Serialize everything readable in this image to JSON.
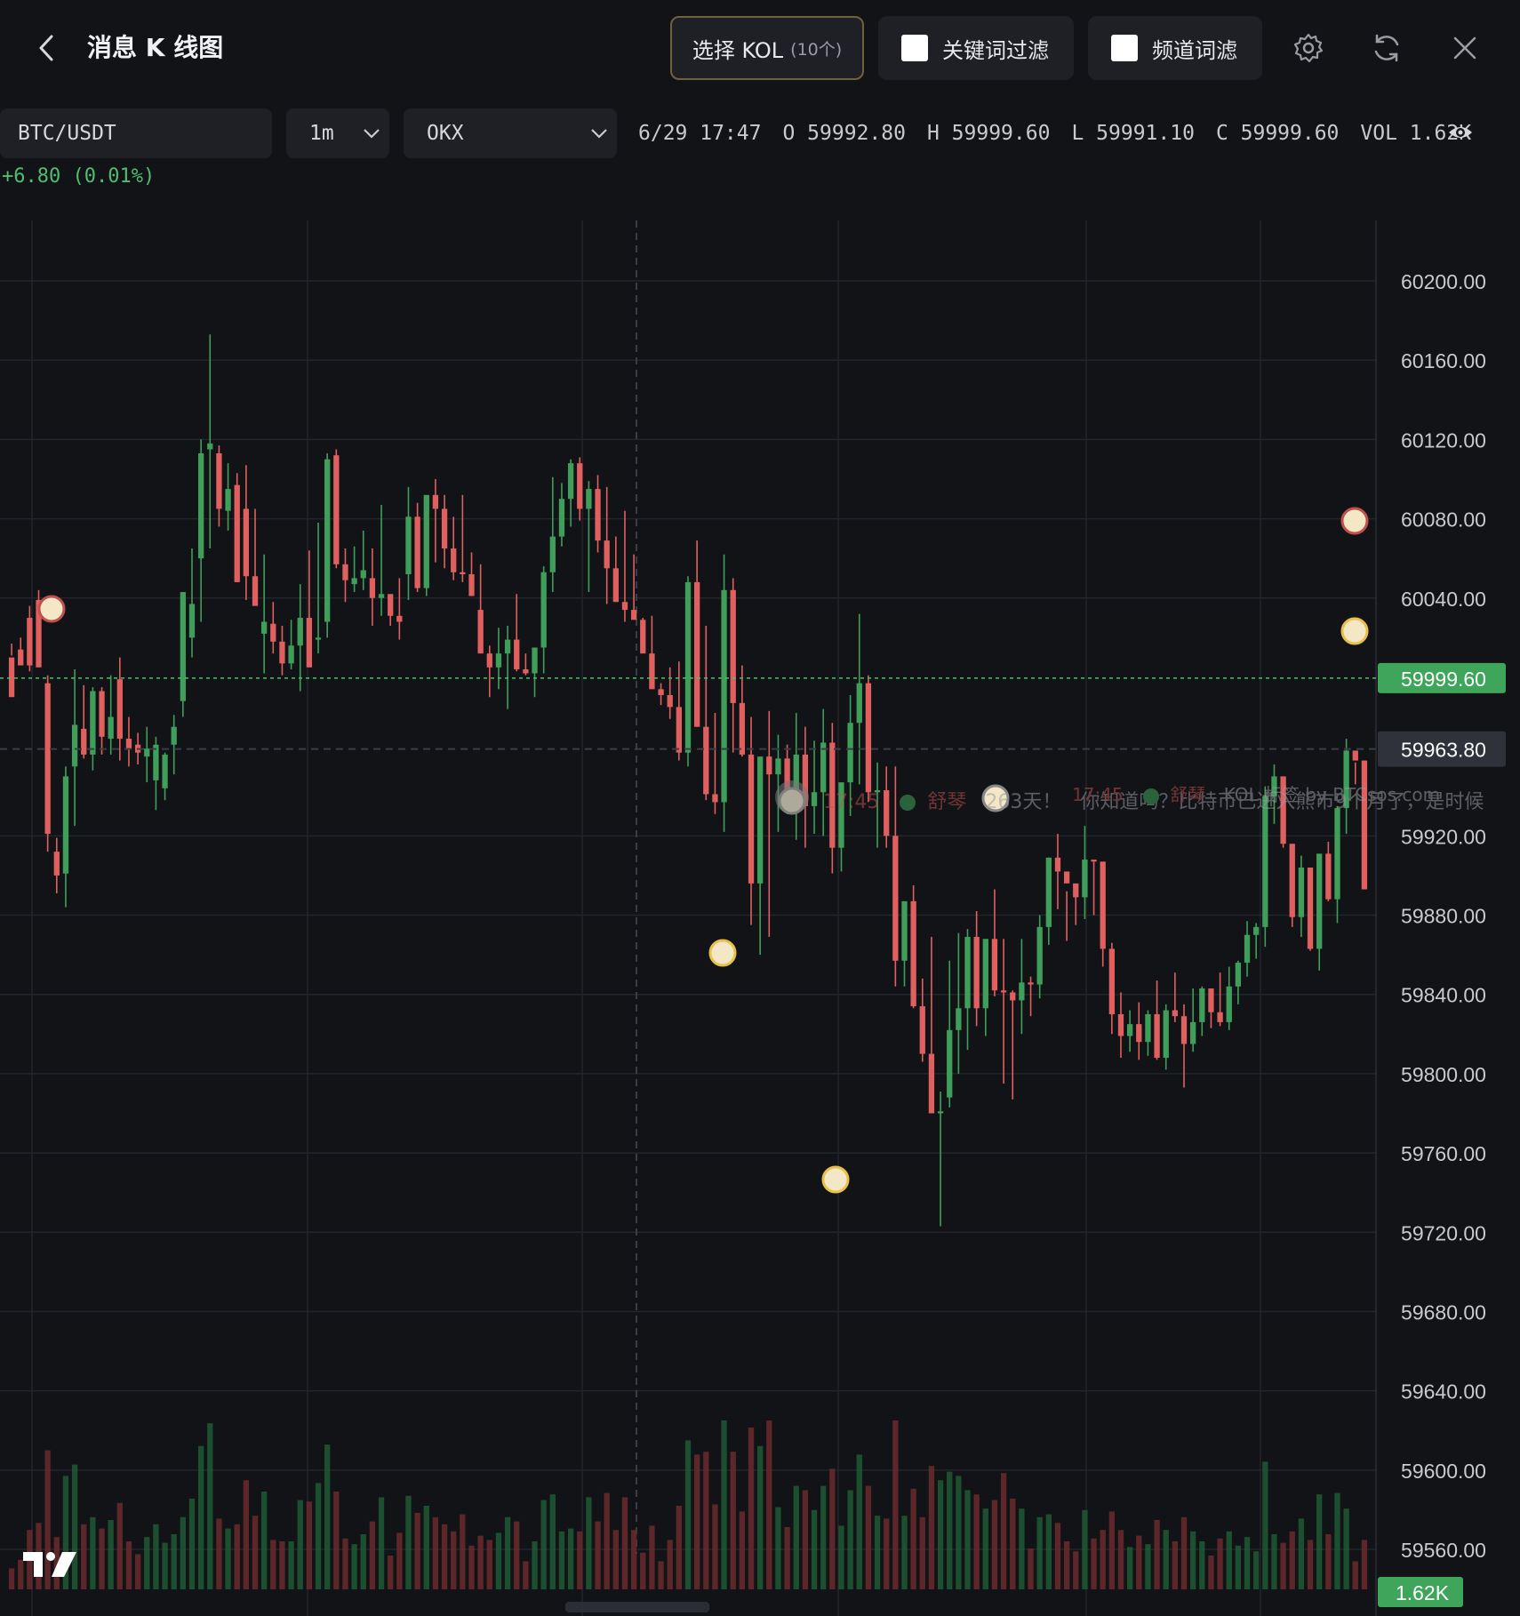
{
  "header": {
    "title": "消息 K 线图",
    "kol_button": "选择 KOL",
    "kol_count": "(10个)",
    "keyword_filter": "关键词过滤",
    "channel_filter": "频道词滤"
  },
  "toolbar": {
    "pair": "BTC/USDT",
    "interval": "1m",
    "exchange": "OKX"
  },
  "ohlc": {
    "datetime": "6/29 17:47",
    "open": "O 59992.80",
    "high": "H 59999.60",
    "low": "L 59991.10",
    "close": "C 59999.60",
    "vol": "VOL 1.62K",
    "change": "+6.80 (0.01%)"
  },
  "colors": {
    "up": "#3f9f5a",
    "down": "#e0605f",
    "bg": "#121317",
    "grid": "#23252c",
    "accent_gold": "#e8c14a"
  },
  "news_marker": {
    "time": "17:45",
    "name": "舒琴",
    "text": "你知道吗？比特币已进入熊市9个月了，是时候",
    "time2": "17:45",
    "name2": "舒琴",
    "prefix": "263天！",
    "watermark": "KOL 标签 by BTCsos.com"
  },
  "chart_data": {
    "type": "candlestick",
    "y_ticks": [
      "60200.00",
      "60160.00",
      "60120.00",
      "60080.00",
      "60040.00",
      "59999.60",
      "59963.80",
      "59920.00",
      "59880.00",
      "59840.00",
      "59800.00",
      "59760.00",
      "59720.00",
      "59680.00",
      "59640.00",
      "59600.00",
      "59560.00"
    ],
    "ylim": [
      59550,
      60220
    ],
    "last_price": "59999.60",
    "crosshair_price": "59963.80",
    "volume_label": "1.62K",
    "candles": [
      [
        60010,
        60017,
        60011,
        59990
      ],
      [
        60014,
        60020,
        60008,
        60006
      ],
      [
        60030,
        60036,
        60003,
        60006
      ],
      [
        60039,
        60044,
        60006,
        60005
      ],
      [
        59997,
        60001,
        59912,
        59921
      ],
      [
        59912,
        59919,
        59891,
        59900
      ],
      [
        59901,
        59955,
        59884,
        59950
      ],
      [
        59955,
        60004,
        59925,
        59976
      ],
      [
        59974,
        59996,
        59959,
        59961
      ],
      [
        59961,
        59995,
        59953,
        59993
      ],
      [
        59993,
        59995,
        59961,
        59970
      ],
      [
        59969,
        60001,
        59961,
        59980
      ],
      [
        59999,
        60010,
        59958,
        59969
      ],
      [
        59969,
        59980,
        59955,
        59964
      ],
      [
        59966,
        59972,
        59956,
        59962
      ],
      [
        59960,
        59975,
        59947,
        59964
      ],
      [
        59948,
        59970,
        59933,
        59966
      ],
      [
        59944,
        59962,
        59938,
        59961
      ],
      [
        59966,
        59981,
        59951,
        59975
      ],
      [
        59988,
        60022,
        59980,
        60043
      ],
      [
        60020,
        60065,
        60010,
        60037
      ],
      [
        60060,
        60120,
        60028,
        60113
      ],
      [
        60115,
        60173,
        60065,
        60118
      ],
      [
        60113,
        60117,
        60076,
        60085
      ],
      [
        60084,
        60108,
        60074,
        60095
      ],
      [
        60097,
        60103,
        60066,
        60048
      ],
      [
        60085,
        60107,
        60039,
        60051
      ],
      [
        60051,
        60085,
        60042,
        60036
      ],
      [
        60022,
        60062,
        60002,
        60028
      ],
      [
        60027,
        60038,
        60012,
        60018
      ],
      [
        60018,
        60026,
        60001,
        60007
      ],
      [
        60007,
        60029,
        60004,
        60016
      ],
      [
        60016,
        60047,
        59993,
        60030
      ],
      [
        60030,
        60064,
        60011,
        60005
      ],
      [
        60019,
        60078,
        60012,
        60020
      ],
      [
        60028,
        60113,
        60020,
        60110
      ],
      [
        60112,
        60115,
        60055,
        60057
      ],
      [
        60057,
        60065,
        60038,
        60049
      ],
      [
        60047,
        60066,
        60043,
        60050
      ],
      [
        60050,
        60074,
        60044,
        60054
      ],
      [
        60050,
        60065,
        60026,
        60040
      ],
      [
        60040,
        60087,
        60031,
        60042
      ],
      [
        60042,
        60041,
        60026,
        60031
      ],
      [
        60031,
        60050,
        60019,
        60028
      ],
      [
        60052,
        60096,
        60039,
        60081
      ],
      [
        60081,
        60088,
        60043,
        60045
      ],
      [
        60045,
        60091,
        60041,
        60092
      ],
      [
        60092,
        60100,
        60058,
        60085
      ],
      [
        60085,
        60092,
        60055,
        60065
      ],
      [
        60065,
        60081,
        60049,
        60053
      ],
      [
        60053,
        60092,
        60048,
        60052
      ],
      [
        60052,
        60063,
        60041,
        60041
      ],
      [
        60034,
        60057,
        60028,
        60012
      ],
      [
        60012,
        60016,
        59990,
        60005
      ],
      [
        60005,
        60025,
        59994,
        60012
      ],
      [
        60012,
        60026,
        59984,
        60019
      ],
      [
        60019,
        60042,
        60003,
        60004
      ],
      [
        60004,
        60012,
        60001,
        60002
      ],
      [
        60002,
        60015,
        59990,
        60015
      ],
      [
        60015,
        60056,
        60002,
        60053
      ],
      [
        60053,
        60101,
        60043,
        60071
      ],
      [
        60071,
        60098,
        60066,
        60090
      ],
      [
        60090,
        60110,
        60076,
        60108
      ],
      [
        60108,
        60111,
        60079,
        60085
      ],
      [
        60085,
        60099,
        60043,
        60095
      ],
      [
        60095,
        60102,
        60063,
        60069
      ],
      [
        60069,
        60096,
        60037,
        60055
      ],
      [
        60055,
        60071,
        60038,
        60038
      ],
      [
        60038,
        60084,
        60028,
        60034
      ],
      [
        60034,
        60062,
        60029,
        60029
      ],
      [
        60029,
        60030,
        60013,
        60012
      ],
      [
        60012,
        60031,
        59995,
        59994
      ],
      [
        59994,
        59997,
        59986,
        59991
      ],
      [
        59991,
        60005,
        59979,
        59985
      ],
      [
        59985,
        60008,
        59958,
        59962
      ],
      [
        59962,
        60051,
        59955,
        60048
      ],
      [
        60048,
        60069,
        59983,
        59975
      ],
      [
        59975,
        60026,
        59938,
        59941
      ],
      [
        59941,
        59982,
        59931,
        59937
      ],
      [
        59937,
        60062,
        59922,
        60044
      ],
      [
        60044,
        60050,
        59962,
        59987
      ],
      [
        59987,
        60006,
        59960,
        59961
      ],
      [
        59961,
        59980,
        59875,
        59896
      ],
      [
        59896,
        59952,
        59860,
        59960
      ],
      [
        59960,
        59983,
        59869,
        59951
      ],
      [
        59951,
        59971,
        59922,
        59959
      ],
      [
        59959,
        59966,
        59931,
        59934
      ],
      [
        59934,
        59982,
        59918,
        59961
      ],
      [
        59961,
        59975,
        59914,
        59935
      ],
      [
        59935,
        59968,
        59921,
        59942
      ],
      [
        59942,
        59984,
        59920,
        59967
      ],
      [
        59967,
        59977,
        59901,
        59914
      ],
      [
        59914,
        59938,
        59902,
        59947
      ],
      [
        59947,
        59991,
        59930,
        59977
      ],
      [
        59977,
        60032,
        59946,
        59997
      ],
      [
        59997,
        60001,
        59937,
        59942
      ],
      [
        59942,
        59957,
        59914,
        59943
      ],
      [
        59943,
        59955,
        59914,
        59920
      ],
      [
        59920,
        59955,
        59844,
        59857
      ],
      [
        59857,
        59887,
        59844,
        59887
      ],
      [
        59887,
        59895,
        59833,
        59834
      ],
      [
        59834,
        59848,
        59806,
        59810
      ],
      [
        59810,
        59869,
        59791,
        59780
      ],
      [
        59780,
        59791,
        59723,
        59781
      ],
      [
        59788,
        59857,
        59783,
        59822
      ],
      [
        59822,
        59871,
        59800,
        59833
      ],
      [
        59833,
        59873,
        59812,
        59869
      ],
      [
        59869,
        59882,
        59824,
        59833
      ],
      [
        59833,
        59867,
        59819,
        59868
      ],
      [
        59868,
        59893,
        59839,
        59842
      ],
      [
        59842,
        59868,
        59795,
        59841
      ],
      [
        59841,
        59842,
        59787,
        59837
      ],
      [
        59837,
        59868,
        59820,
        59846
      ],
      [
        59846,
        59849,
        59829,
        59845
      ],
      [
        59845,
        59880,
        59838,
        59874
      ],
      [
        59874,
        59909,
        59865,
        59909
      ],
      [
        59909,
        59921,
        59883,
        59902
      ],
      [
        59902,
        59892,
        59867,
        59896
      ],
      [
        59896,
        59893,
        59875,
        59889
      ],
      [
        59889,
        59925,
        59878,
        59908
      ],
      [
        59908,
        59907,
        59880,
        59907
      ],
      [
        59907,
        59887,
        59854,
        59863
      ],
      [
        59863,
        59866,
        59820,
        59830
      ],
      [
        59830,
        59841,
        59808,
        59819
      ],
      [
        59819,
        59832,
        59811,
        59825
      ],
      [
        59825,
        59836,
        59807,
        59816
      ],
      [
        59816,
        59832,
        59809,
        59830
      ],
      [
        59830,
        59847,
        59807,
        59808
      ],
      [
        59808,
        59835,
        59802,
        59832
      ],
      [
        59832,
        59851,
        59826,
        59829
      ],
      [
        59829,
        59835,
        59793,
        59815
      ],
      [
        59815,
        59843,
        59811,
        59826
      ],
      [
        59826,
        59844,
        59819,
        59843
      ],
      [
        59843,
        59838,
        59823,
        59831
      ],
      [
        59831,
        59851,
        59824,
        59826
      ],
      [
        59826,
        59854,
        59822,
        59844
      ],
      [
        59844,
        59857,
        59835,
        59856
      ],
      [
        59856,
        59877,
        59849,
        59870
      ],
      [
        59870,
        59876,
        59858,
        59874
      ],
      [
        59874,
        59945,
        59864,
        59940
      ],
      [
        59940,
        59956,
        59926,
        59950
      ],
      [
        59950,
        59938,
        59914,
        59916
      ],
      [
        59916,
        59906,
        59874,
        59879
      ],
      [
        59879,
        59910,
        59869,
        59904
      ],
      [
        59904,
        59888,
        59862,
        59863
      ],
      [
        59863,
        59910,
        59852,
        59911
      ],
      [
        59911,
        59917,
        59887,
        59888
      ],
      [
        59888,
        59935,
        59876,
        59934
      ],
      [
        59934,
        59969,
        59921,
        59963
      ],
      [
        59963,
        59957,
        59946,
        59958
      ],
      [
        59958,
        59944,
        59918,
        59893
      ]
    ]
  }
}
